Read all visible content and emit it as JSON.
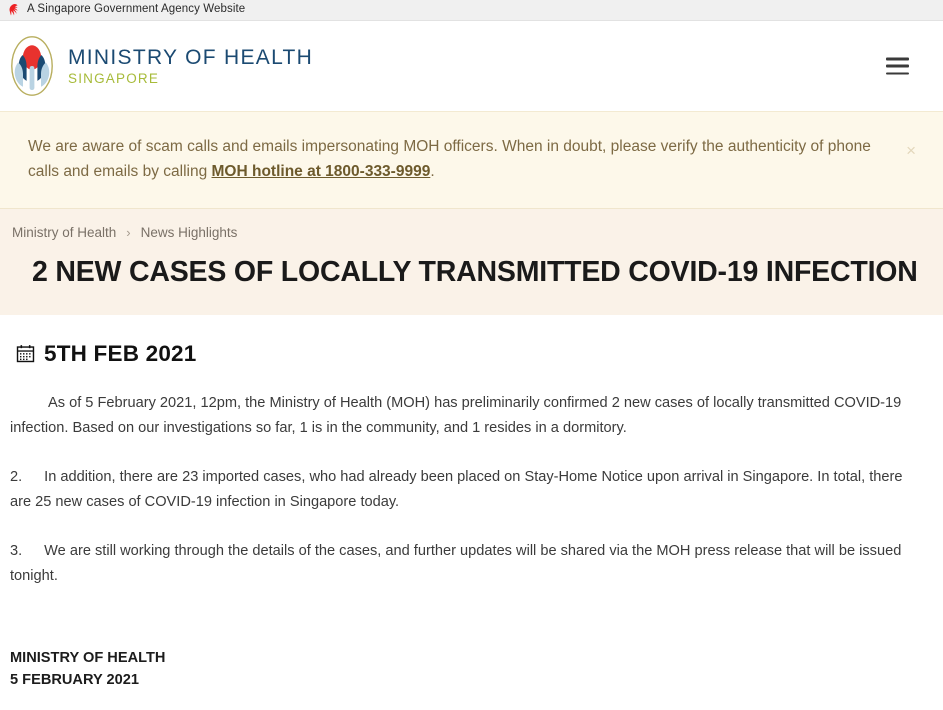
{
  "gov_bar": {
    "icon": "singapore-lion-icon",
    "text": "A Singapore Government Agency Website"
  },
  "masthead": {
    "logo_icon": "moh-lotus-logo",
    "brand_title": "MINISTRY OF HEALTH",
    "brand_subtitle": "SINGAPORE",
    "menu_icon": "hamburger-menu-icon"
  },
  "alert": {
    "text_before": "We are aware of scam calls and emails impersonating MOH officers. When in doubt, please verify the authenticity of phone calls and emails by calling ",
    "hotline_link": "MOH hotline at 1800-333-9999",
    "text_after": ".",
    "close_label": "×"
  },
  "breadcrumb": {
    "items": [
      {
        "label": "Ministry of Health"
      },
      {
        "label": "News Highlights"
      }
    ],
    "separator": "›"
  },
  "hero": {
    "title": "2 NEW CASES OF LOCALLY TRANSMITTED COVID-19 INFECTION"
  },
  "article": {
    "date_icon": "calendar-icon",
    "date": "5TH FEB 2021",
    "paragraphs": [
      {
        "number": "",
        "text": "As of 5 February 2021, 12pm, the Ministry of Health (MOH) has preliminarily confirmed 2 new cases of locally transmitted COVID-19 infection. Based on our investigations so far, 1 is in the community, and 1 resides in a dormitory."
      },
      {
        "number": "2.",
        "text": "In addition, there are 23 imported cases, who had already been placed on Stay-Home Notice upon arrival in Singapore. In total, there are 25 new cases of COVID-19 infection in Singapore today."
      },
      {
        "number": "3.",
        "text": "We are still working through the details of the cases, and further updates will be shared via the MOH press release that will be issued tonight."
      }
    ],
    "signoff_org": "MINISTRY OF HEALTH",
    "signoff_date": "5 FEBRUARY 2021"
  },
  "colors": {
    "gov_bar_bg": "#f0f0f0",
    "brand_blue": "#1b4a72",
    "brand_green": "#a7bb3a",
    "alert_bg": "#fdf8ea",
    "alert_text": "#7d6a44",
    "hero_bg": "#faf2e8",
    "lion_red": "#ed2224"
  }
}
